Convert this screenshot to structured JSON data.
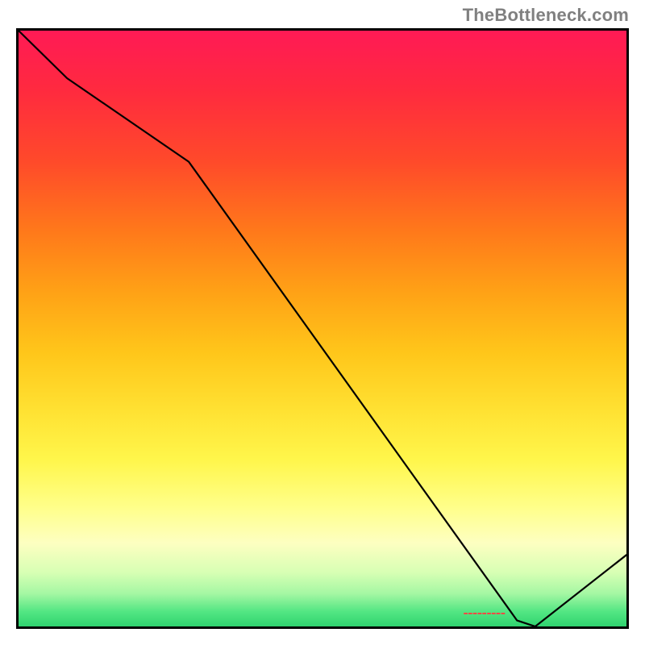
{
  "watermark": "TheBottleneck.com",
  "chart_data": {
    "type": "line",
    "x": [
      0.0,
      0.08,
      0.28,
      0.82,
      0.85,
      1.0
    ],
    "values": [
      1.0,
      0.92,
      0.78,
      0.01,
      0.0,
      0.12
    ],
    "title": "",
    "xlabel": "",
    "ylabel": "",
    "xlim": [
      0,
      1
    ],
    "ylim": [
      0,
      1
    ],
    "annotation_text": "▬▬▬▬▬▬▬▬▬",
    "annotation_xy": [
      0.772,
      0.015
    ],
    "gradient_stops": [
      {
        "pos": 0.0,
        "color": "#ff1a55"
      },
      {
        "pos": 0.5,
        "color": "#ffc61a"
      },
      {
        "pos": 0.8,
        "color": "#ffff8a"
      },
      {
        "pos": 1.0,
        "color": "#2fd36f"
      }
    ]
  }
}
